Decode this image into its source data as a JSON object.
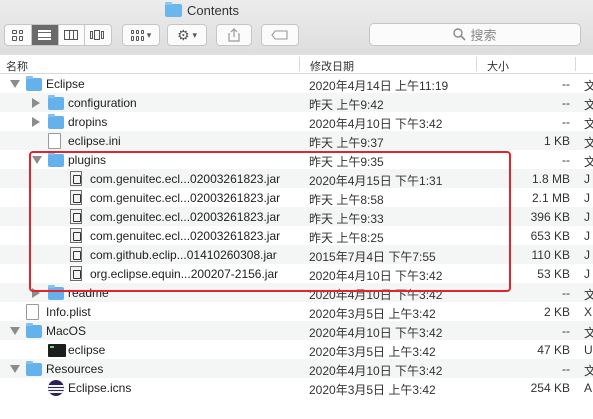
{
  "window": {
    "title": "Contents"
  },
  "toolbar": {
    "search_placeholder": "搜索",
    "icons": [
      "icon-view-icon",
      "list-view-icon",
      "column-view-icon",
      "cover-flow-icon",
      "group-icon",
      "gear-icon",
      "share-icon",
      "tag-icon",
      "search-icon"
    ]
  },
  "columns": {
    "name": "名称",
    "date": "修改日期",
    "size": "大小"
  },
  "rows": [
    {
      "name": "Eclipse",
      "date": "2020年4月14日 上午11:19",
      "size": "--",
      "kind": "文",
      "type": "folder",
      "level": 0,
      "disclosure": "open"
    },
    {
      "name": "configuration",
      "date": "昨天 上午9:42",
      "size": "--",
      "kind": "文",
      "type": "folder",
      "level": 1,
      "disclosure": "closed"
    },
    {
      "name": "dropins",
      "date": "2020年4月10日 下午3:42",
      "size": "--",
      "kind": "文",
      "type": "folder",
      "level": 1,
      "disclosure": "closed"
    },
    {
      "name": "eclipse.ini",
      "date": "昨天 上午9:37",
      "size": "1 KB",
      "kind": "文",
      "type": "doc",
      "level": 1,
      "disclosure": "none"
    },
    {
      "name": "plugins",
      "date": "昨天 上午9:35",
      "size": "--",
      "kind": "文",
      "type": "folder",
      "level": 1,
      "disclosure": "open"
    },
    {
      "name": "com.genuitec.ecl...02003261823.jar",
      "date": "2020年4月15日 下午1:31",
      "size": "1.8 MB",
      "kind": "J",
      "type": "jar",
      "level": 2,
      "disclosure": "none"
    },
    {
      "name": "com.genuitec.ecl...02003261823.jar",
      "date": "昨天 上午8:58",
      "size": "2.1 MB",
      "kind": "J",
      "type": "jar",
      "level": 2,
      "disclosure": "none"
    },
    {
      "name": "com.genuitec.ecl...02003261823.jar",
      "date": "昨天 上午9:33",
      "size": "396 KB",
      "kind": "J",
      "type": "jar",
      "level": 2,
      "disclosure": "none"
    },
    {
      "name": "com.genuitec.ecl...02003261823.jar",
      "date": "昨天 上午8:25",
      "size": "653 KB",
      "kind": "J",
      "type": "jar",
      "level": 2,
      "disclosure": "none"
    },
    {
      "name": "com.github.eclip...01410260308.jar",
      "date": "2015年7月4日 下午7:55",
      "size": "110 KB",
      "kind": "J",
      "type": "jar",
      "level": 2,
      "disclosure": "none"
    },
    {
      "name": "org.eclipse.equin...200207-2156.jar",
      "date": "2020年4月10日 下午3:42",
      "size": "53 KB",
      "kind": "J",
      "type": "jar",
      "level": 2,
      "disclosure": "none"
    },
    {
      "name": "readme",
      "date": "2020年4月10日 下午3:42",
      "size": "--",
      "kind": "文",
      "type": "folder",
      "level": 1,
      "disclosure": "closed"
    },
    {
      "name": "Info.plist",
      "date": "2020年3月5日 上午3:42",
      "size": "2 KB",
      "kind": "X",
      "type": "doc",
      "level": 0,
      "disclosure": "none"
    },
    {
      "name": "MacOS",
      "date": "2020年4月10日 下午3:42",
      "size": "--",
      "kind": "文",
      "type": "folder",
      "level": 0,
      "disclosure": "open"
    },
    {
      "name": "eclipse",
      "date": "2020年3月5日 上午3:42",
      "size": "47 KB",
      "kind": "U",
      "type": "exec",
      "level": 1,
      "disclosure": "none"
    },
    {
      "name": "Resources",
      "date": "2020年4月10日 下午3:42",
      "size": "--",
      "kind": "文",
      "type": "folder",
      "level": 0,
      "disclosure": "open"
    },
    {
      "name": "Eclipse.icns",
      "date": "2020年3月5日 上午3:42",
      "size": "254 KB",
      "kind": "A",
      "type": "icns",
      "level": 1,
      "disclosure": "none"
    }
  ],
  "colors": {
    "folder": "#65b1ec",
    "highlight_border": "#e3242b",
    "alt_row": "#f4f5f5"
  }
}
